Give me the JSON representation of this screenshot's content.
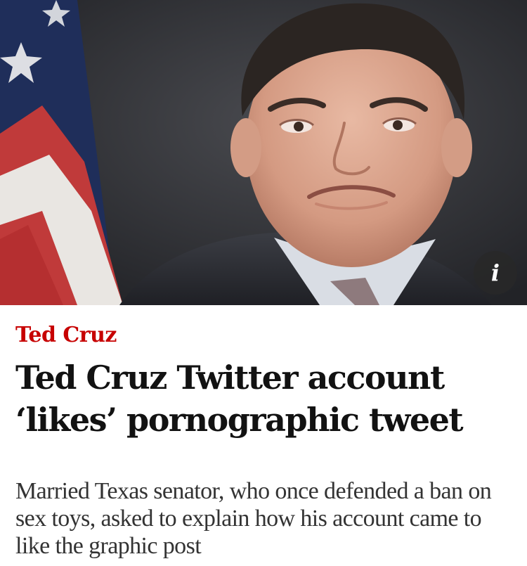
{
  "article": {
    "kicker": "Ted Cruz",
    "headline": "Ted Cruz Twitter account ‘likes’ pornographic tweet",
    "standfirst": "Married Texas senator, who once defended a ban on sex toys, asked to explain how his account came to like the graphic post"
  },
  "image": {
    "info_glyph": "i",
    "subject": "man-in-suit-portrait",
    "background": "american-flag"
  },
  "colors": {
    "kicker": "#c70000",
    "headline": "#121212",
    "standfirst": "#333333",
    "background": "#ffffff"
  }
}
